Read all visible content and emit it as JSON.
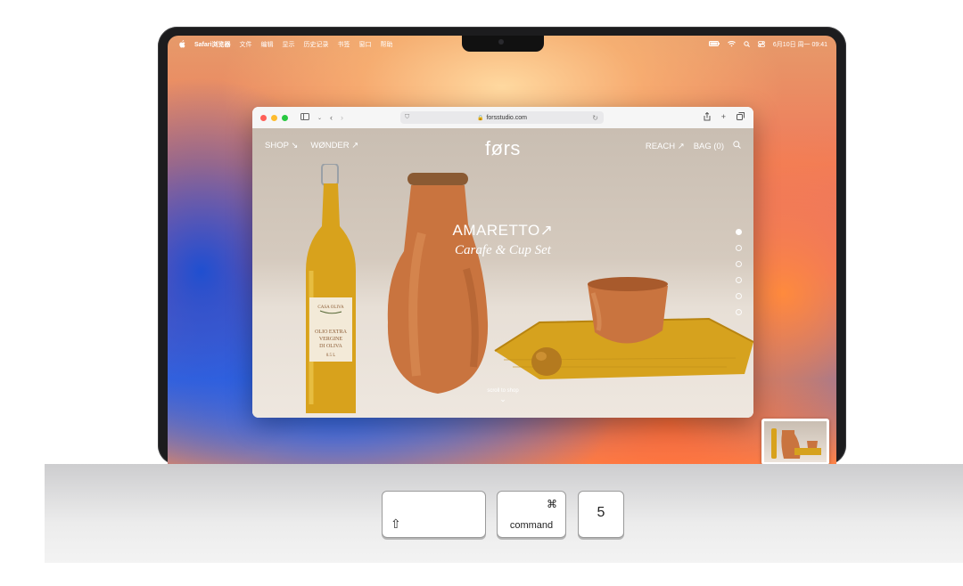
{
  "menubar": {
    "apple_icon": "apple-icon",
    "app_name": "Safari浏览器",
    "menus": [
      "文件",
      "编辑",
      "显示",
      "历史记录",
      "书签",
      "窗口",
      "帮助"
    ],
    "clock": "6月10日 周一  09:41"
  },
  "browser": {
    "url": "forsstudio.com",
    "icons": [
      "sidebar-icon",
      "back-icon",
      "forward-icon",
      "share-icon",
      "new-tab-icon",
      "tabs-overview-icon"
    ]
  },
  "site": {
    "nav_left": [
      "SHOP ↘",
      "WØNDER ↗"
    ],
    "logo": "førs",
    "nav_right": [
      "REACH ↗",
      "BAG (0)"
    ],
    "search_icon": "search-icon"
  },
  "hero": {
    "title": "AMARETTO↗",
    "subtitle": "Carafe & Cup Set",
    "scroll_label": "scroll to shop",
    "slides_total": 6,
    "active_slide": 1
  },
  "bottle_label": {
    "line1": "CASA OLIVA",
    "line2": "OLIO EXTRA",
    "line3": "VERGINE",
    "line4": "DI OLIVA",
    "line5": "0.5 L"
  },
  "keys": {
    "shift_symbol": "⇧",
    "command_symbol": "⌘",
    "command_label": "command",
    "five_label": "5"
  },
  "colors": {
    "terracotta": "#c9743f",
    "oil": "#d8a21c",
    "cloth": "#d6a21e"
  }
}
